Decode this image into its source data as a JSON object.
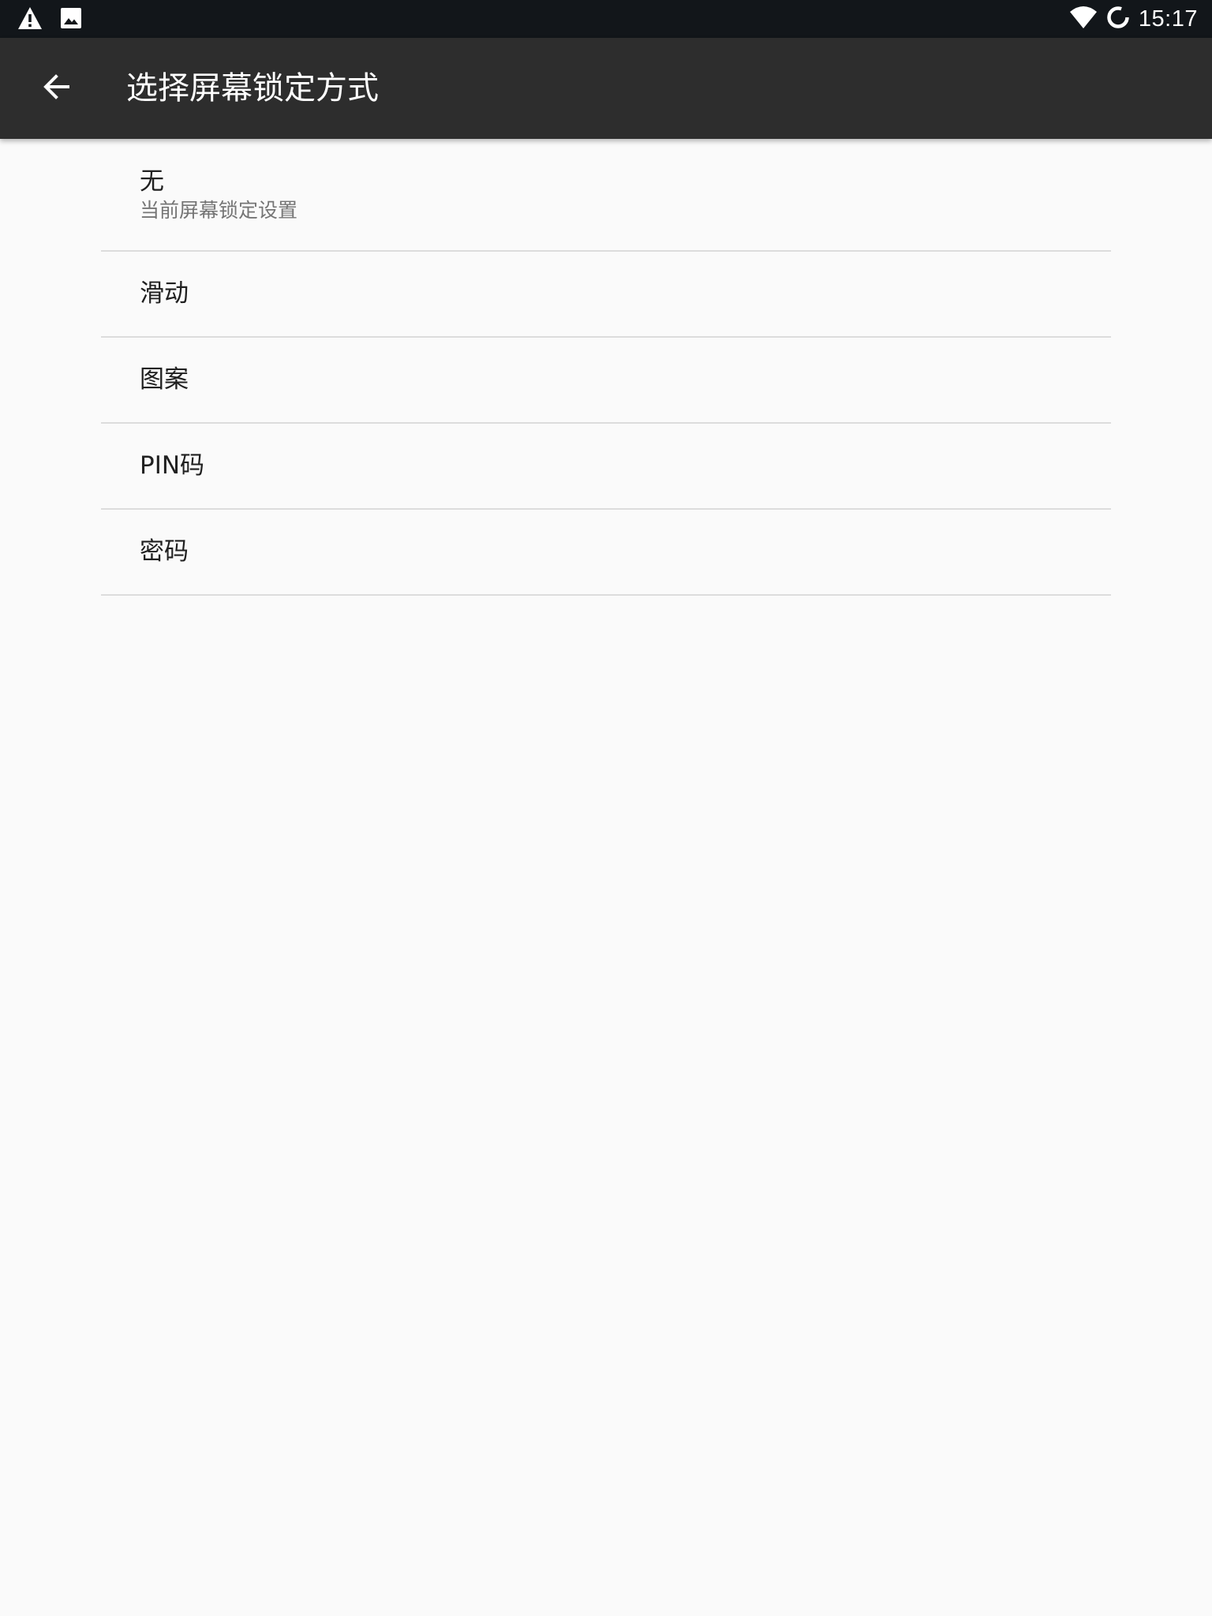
{
  "status_bar": {
    "time": "15:17",
    "left_icons": [
      "warning-icon",
      "image-icon"
    ],
    "right_icons": [
      "wifi-icon",
      "sync-icon"
    ]
  },
  "app_bar": {
    "title": "选择屏幕锁定方式",
    "back_icon": "arrow-back-icon",
    "background": "#2d2d2d"
  },
  "lock_options": [
    {
      "title": "无",
      "summary": "当前屏幕锁定设置"
    },
    {
      "title": "滑动"
    },
    {
      "title": "图案"
    },
    {
      "title": "PIN码"
    },
    {
      "title": "密码"
    }
  ],
  "colors": {
    "status_bar": "#12161a",
    "page_background": "#fafafa",
    "divider": "#dcdcdc",
    "primary_text": "#202020",
    "secondary_text": "#757575"
  }
}
